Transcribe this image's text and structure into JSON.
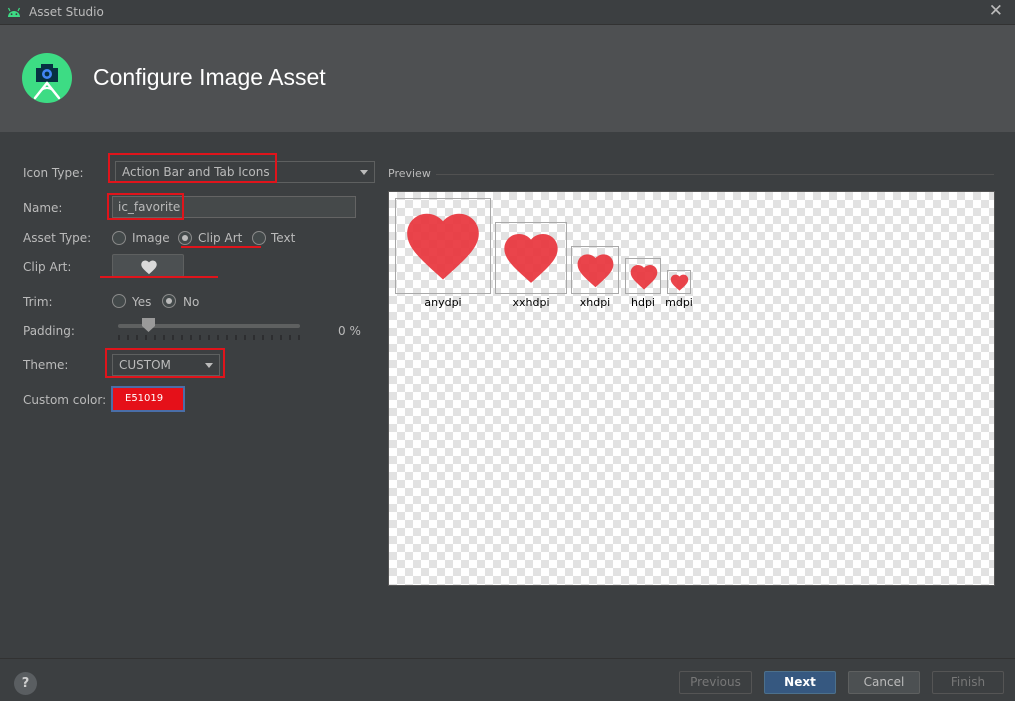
{
  "window": {
    "title": "Asset Studio",
    "close_glyph": "✕"
  },
  "header": {
    "title": "Configure Image Asset"
  },
  "form": {
    "icon_type": {
      "label": "Icon Type:",
      "value": "Action Bar and Tab Icons"
    },
    "name": {
      "label": "Name:",
      "value": "ic_favorite"
    },
    "asset_type": {
      "label": "Asset Type:",
      "options": [
        "Image",
        "Clip Art",
        "Text"
      ],
      "selected": "Clip Art"
    },
    "clip_art": {
      "label": "Clip Art:",
      "icon": "heart-icon"
    },
    "trim": {
      "label": "Trim:",
      "options": [
        "Yes",
        "No"
      ],
      "selected": "No"
    },
    "padding": {
      "label": "Padding:",
      "value": "0 %",
      "fraction": 0.17
    },
    "theme": {
      "label": "Theme:",
      "value": "CUSTOM"
    },
    "custom_color": {
      "label": "Custom color:",
      "value": "E51019",
      "hex": "#E51019"
    }
  },
  "preview": {
    "label": "Preview",
    "densities": [
      "anydpi",
      "xxhdpi",
      "xhdpi",
      "hdpi",
      "mdpi"
    ],
    "icon_color": "#E8343C"
  },
  "footer": {
    "help": "?",
    "buttons": {
      "previous": "Previous",
      "next": "Next",
      "cancel": "Cancel",
      "finish": "Finish"
    }
  }
}
